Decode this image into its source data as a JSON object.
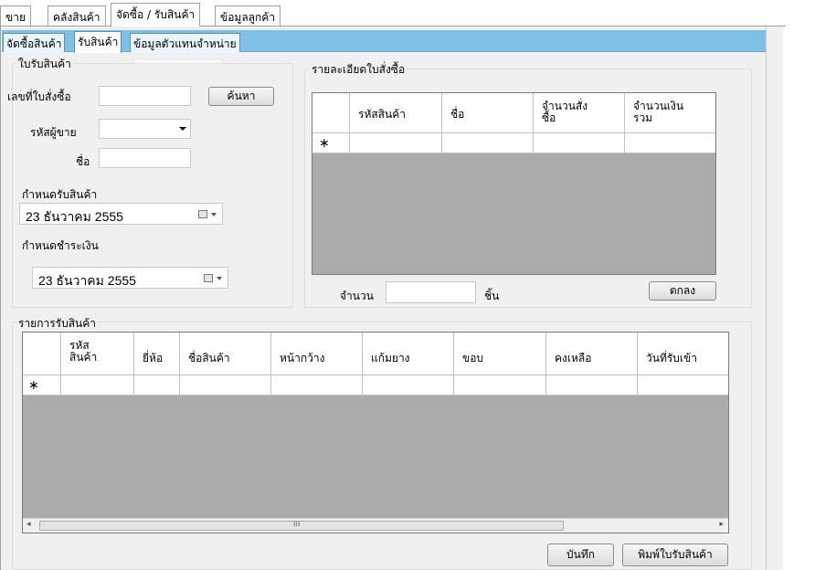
{
  "main_tabs": [
    "ขาย",
    "คลังสินค้า",
    "จัดซื้อ / รับสินค้า",
    "ข้อมูลลูกค้า"
  ],
  "sub_tabs": [
    "จัดซื้อสินค้า",
    "รับสินค้า",
    "ข้อมูลตัวแทนจำหน่าย"
  ],
  "receipt": {
    "group_title": "ใบรับสินค้า",
    "po_number_label": "เลขที่ใบสั่งซื้อ",
    "po_number_value": "",
    "search_button": "ค้นหา",
    "vendor_code_label": "รหัสผู้ขาย",
    "vendor_code_value": "",
    "name_label": "ชื่อ",
    "name_value": "",
    "receive_date_label": "กำหนดรับสินค้า",
    "receive_date": "23  ธันวาคม    2555",
    "payment_date_label": "กำหนดชำระเงิน",
    "payment_date": "23  ธันวาคม    2555"
  },
  "po_details": {
    "group_title": "รายละเอียดใบสั่งซื้อ",
    "columns": [
      "รหัสสินค้า",
      "ชื่อ",
      "จำนวนสั่ง\nซื้อ",
      "จำนวนเงิน\nรวม"
    ],
    "new_row_marker": "∗",
    "quantity_label": "จำนวน",
    "quantity_value": "",
    "unit_label": "ชิ้น",
    "ok_button": "ตกลง"
  },
  "receive_list": {
    "group_title": "รายการรับสินค้า",
    "columns": [
      "รหัส\nสินค้า",
      "ยี่ห้อ",
      "ชื่อสินค้า",
      "หน้ากว้าง",
      "แก้มยาง",
      "ขอบ",
      "คงเหลือ",
      "วันที่รับเข้า"
    ],
    "new_row_marker": "∗",
    "scroll_grip": "ııı",
    "save_button": "บันทึก",
    "print_button": "พิมพ์ใบรับสินค้า"
  }
}
